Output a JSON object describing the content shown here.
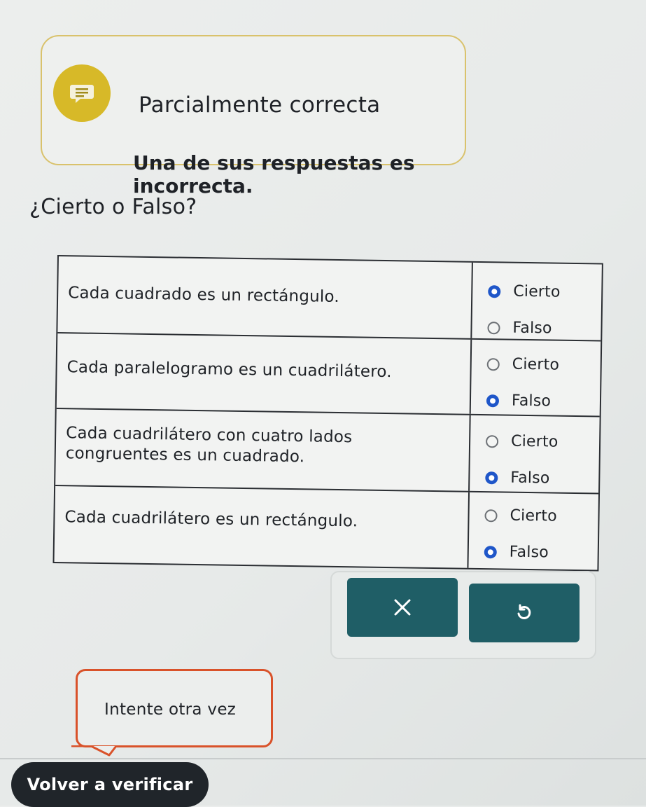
{
  "feedback": {
    "title": "Parcialmente correcta",
    "message": "Una de sus respuestas es incorrecta.",
    "icon": "speech-bubble-icon",
    "accent_color": "#d7b928"
  },
  "question": "¿Cierto o Falso?",
  "rows": [
    {
      "statement": "Cada cuadrado es un rectángulo.",
      "options": [
        {
          "label": "Cierto",
          "selected": true
        },
        {
          "label": "Falso",
          "selected": false
        }
      ]
    },
    {
      "statement": "Cada paralelogramo es un cuadrilátero.",
      "options": [
        {
          "label": "Cierto",
          "selected": false
        },
        {
          "label": "Falso",
          "selected": true
        }
      ]
    },
    {
      "statement": "Cada cuadrilátero con cuatro lados congruentes es un cuadrado.",
      "options": [
        {
          "label": "Cierto",
          "selected": false
        },
        {
          "label": "Falso",
          "selected": true
        }
      ]
    },
    {
      "statement": "Cada cuadrilátero es un rectángulo.",
      "options": [
        {
          "label": "Cierto",
          "selected": false
        },
        {
          "label": "Falso",
          "selected": true
        }
      ]
    }
  ],
  "actions": {
    "clear_icon": "close-icon",
    "reset_icon": "undo-icon",
    "button_color": "#1f5e66"
  },
  "hint": {
    "text": "Intente otra vez",
    "border_color": "#d9522a"
  },
  "check_button": {
    "label": "Volver a verificar"
  }
}
